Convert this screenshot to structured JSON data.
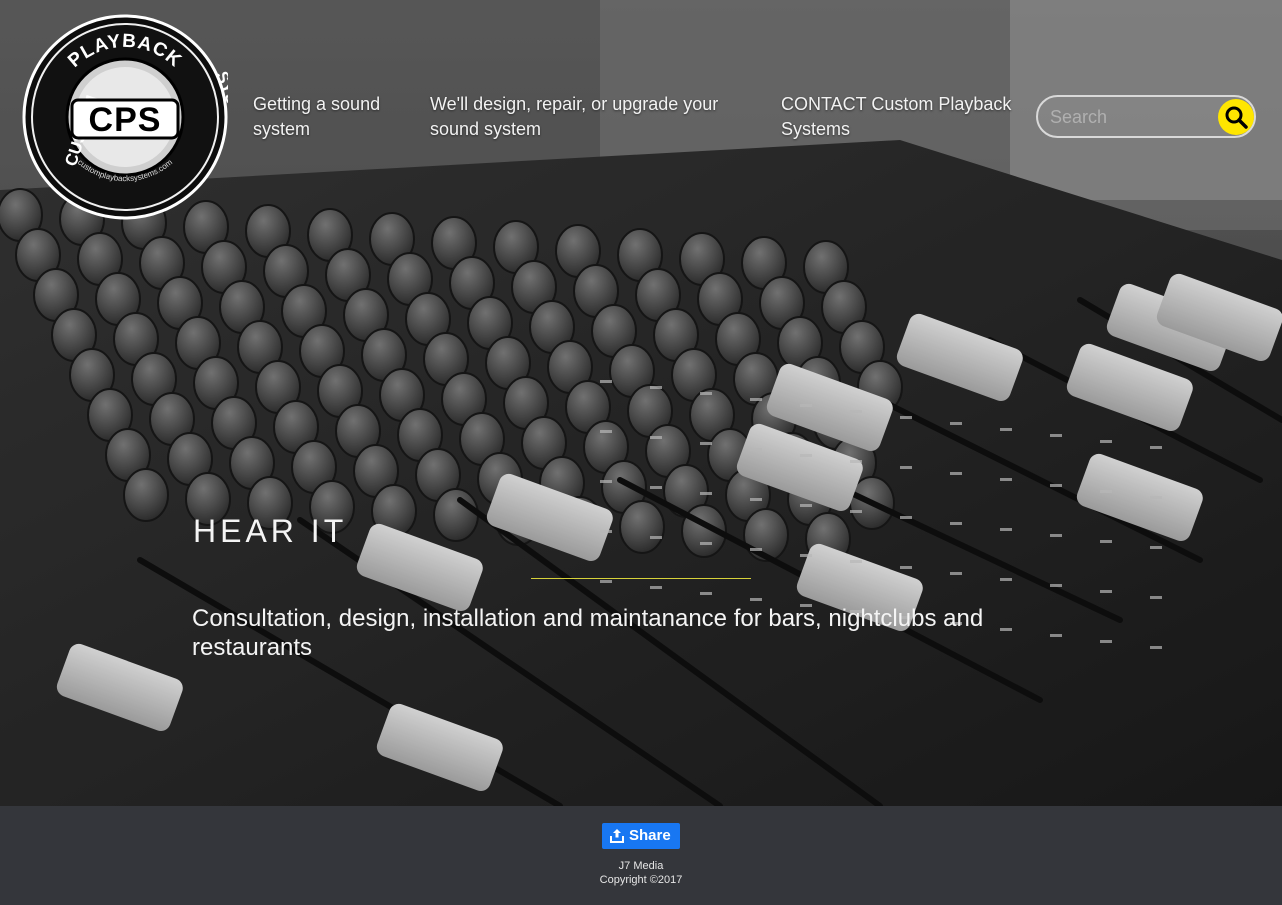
{
  "logo": {
    "arc_top": "PLAYBACK",
    "arc_left": "CUSTOM",
    "arc_right": "SYSTEMS",
    "monogram": "CPS",
    "url_text": "customplaybacksystems.com"
  },
  "nav": {
    "items": [
      {
        "label": "Getting a sound system"
      },
      {
        "label": "We'll design, repair, or upgrade your sound system"
      },
      {
        "label": "CONTACT Custom Playback Systems"
      }
    ]
  },
  "search": {
    "placeholder": "Search",
    "button_color": "#ffe600"
  },
  "hero": {
    "title": "HEAR IT",
    "subtitle": "Consultation, design, installation and maintanance for bars, nightclubs and restaurants",
    "rule_color": "#d7d23a",
    "background_description_icon": "mixing-console-photo"
  },
  "footer": {
    "share_label": "Share",
    "share_color": "#1877f2",
    "credit": "J7 Media",
    "copyright": "Copyright ©2017"
  }
}
